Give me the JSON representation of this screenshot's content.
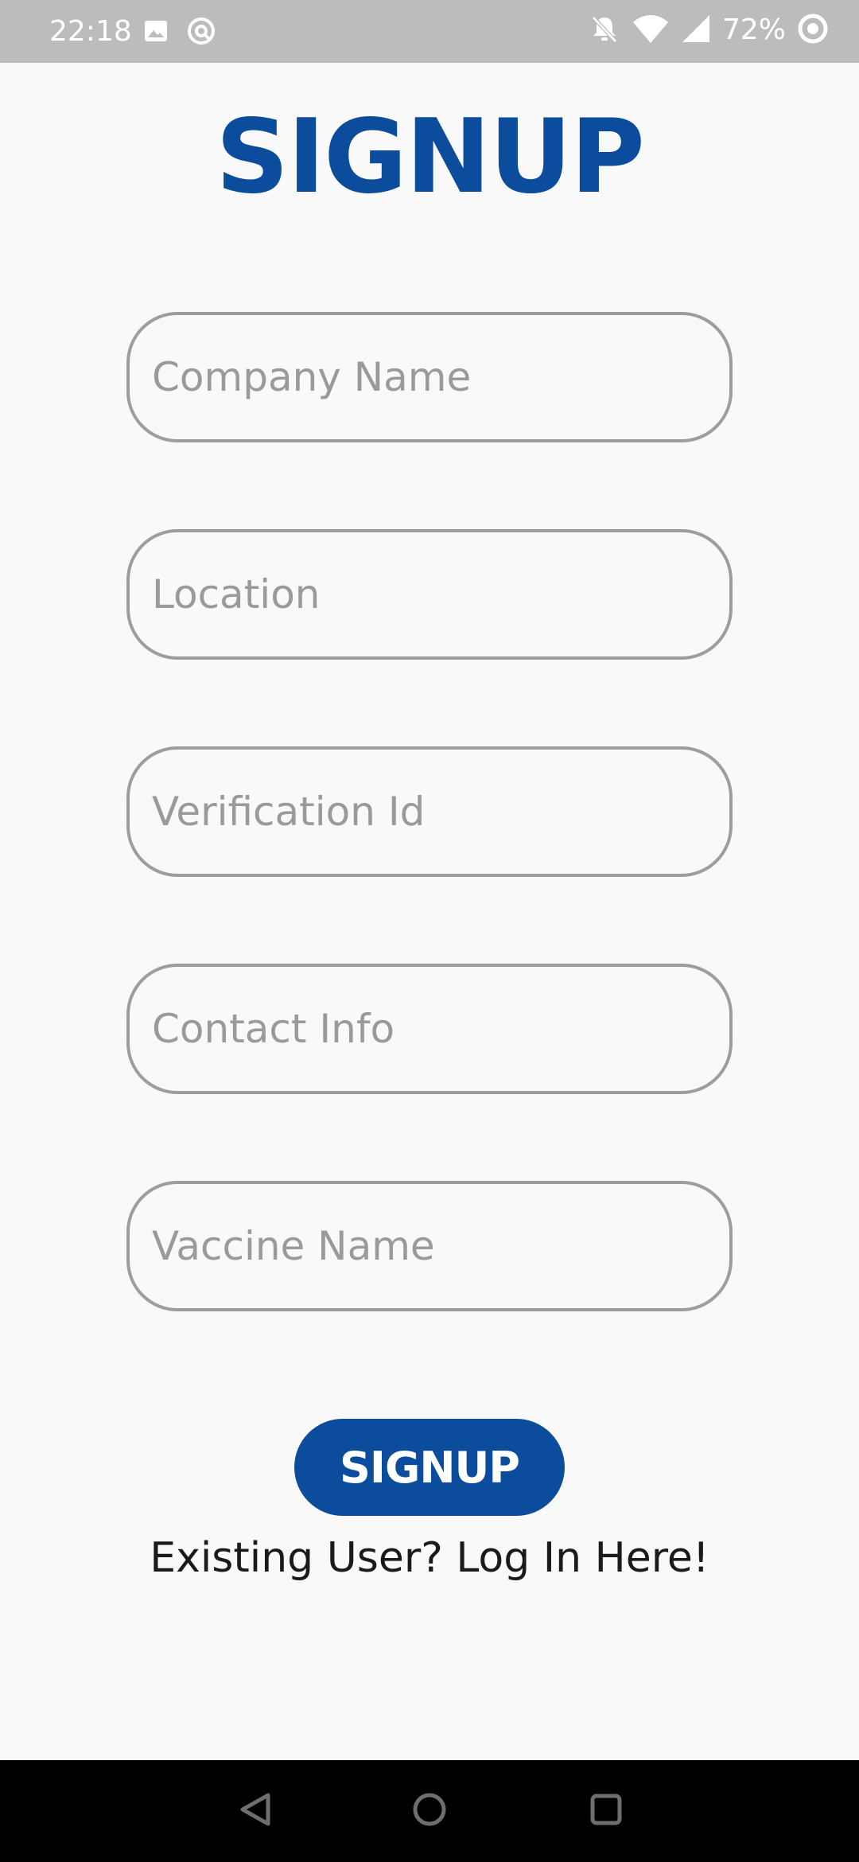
{
  "status_bar": {
    "time": "22:18",
    "battery": "72%",
    "icons": [
      "image-icon",
      "sync-icon",
      "mute-icon",
      "wifi-icon",
      "signal-icon",
      "battery-saver-icon"
    ]
  },
  "page": {
    "title": "SIGNUP"
  },
  "form": {
    "fields": [
      {
        "name": "company_name",
        "placeholder": "Company Name",
        "value": ""
      },
      {
        "name": "location",
        "placeholder": "Location",
        "value": ""
      },
      {
        "name": "verification_id",
        "placeholder": "Verification Id",
        "value": ""
      },
      {
        "name": "contact_info",
        "placeholder": "Contact Info",
        "value": ""
      },
      {
        "name": "vaccine_name",
        "placeholder": "Vaccine Name",
        "value": ""
      }
    ],
    "submit_label": "SIGNUP",
    "login_link": "Existing User? Log In Here!"
  },
  "nav_bar": {
    "icons": [
      "back-icon",
      "home-icon",
      "recents-icon"
    ]
  },
  "colors": {
    "accent": "#0b4c9c",
    "status_bar": "#bcbcbc",
    "background": "#f9f9f9",
    "field_border": "#9d9d9d"
  }
}
